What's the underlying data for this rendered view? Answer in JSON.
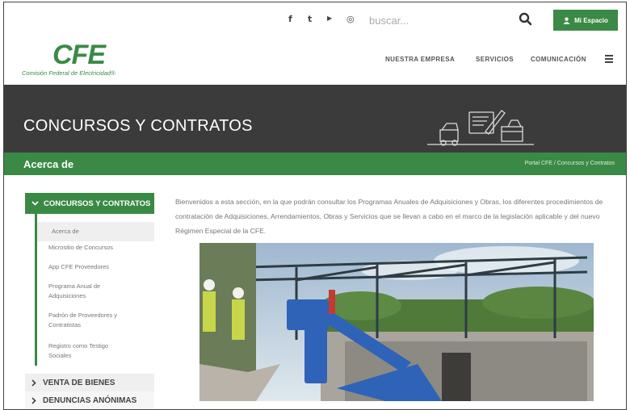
{
  "topbar": {
    "social_icons": [
      "facebook-icon",
      "twitter-icon",
      "youtube-icon",
      "instagram-icon"
    ],
    "social_glyphs": [
      "f",
      "t",
      "▶",
      "◎"
    ],
    "search_placeholder": "buscar...",
    "mi_espacio_label": "Mi Espacio"
  },
  "header": {
    "logo_text": "CFE",
    "logo_subtitle": "Comisión Federal de Electricidad®",
    "nav": [
      "NUESTRA EMPRESA",
      "SERVICIOS",
      "COMUNICACIÓN"
    ]
  },
  "hero": {
    "title": "CONCURSOS Y CONTRATOS"
  },
  "section": {
    "title": "Acerca de",
    "breadcrumb": [
      "Portal CFE",
      "Concursos y Contratos"
    ]
  },
  "sidebar": {
    "expanded_label": "CONCURSOS Y CONTRATOS",
    "items": [
      "Acerca de",
      "Micrositio de Concursos",
      "App CFE Proveedores",
      "Programa Anual de Adquisiciones",
      "Padrón de Proveedores y Contratistas",
      "Registro como Testigo Sociales"
    ],
    "collapsed": [
      "VENTA DE BIENES",
      "DENUNCIAS ANÓNIMAS"
    ]
  },
  "main": {
    "intro": "Bienvenidos a esta sección, en la que podrán consultar los Programas Anuales de Adquisiciones y Obras, los diferentes procedimientos de contratación de Adquisiciones, Arrendamientos, Obras y Servicios que se llevan a cabo en el marco de la legislación aplicable y del nuevo Régimen Especial de la CFE."
  },
  "colors": {
    "brand_green": "#3a8a45",
    "hero_dark": "#3b3b3b",
    "sidebar_gray": "#efefef"
  }
}
